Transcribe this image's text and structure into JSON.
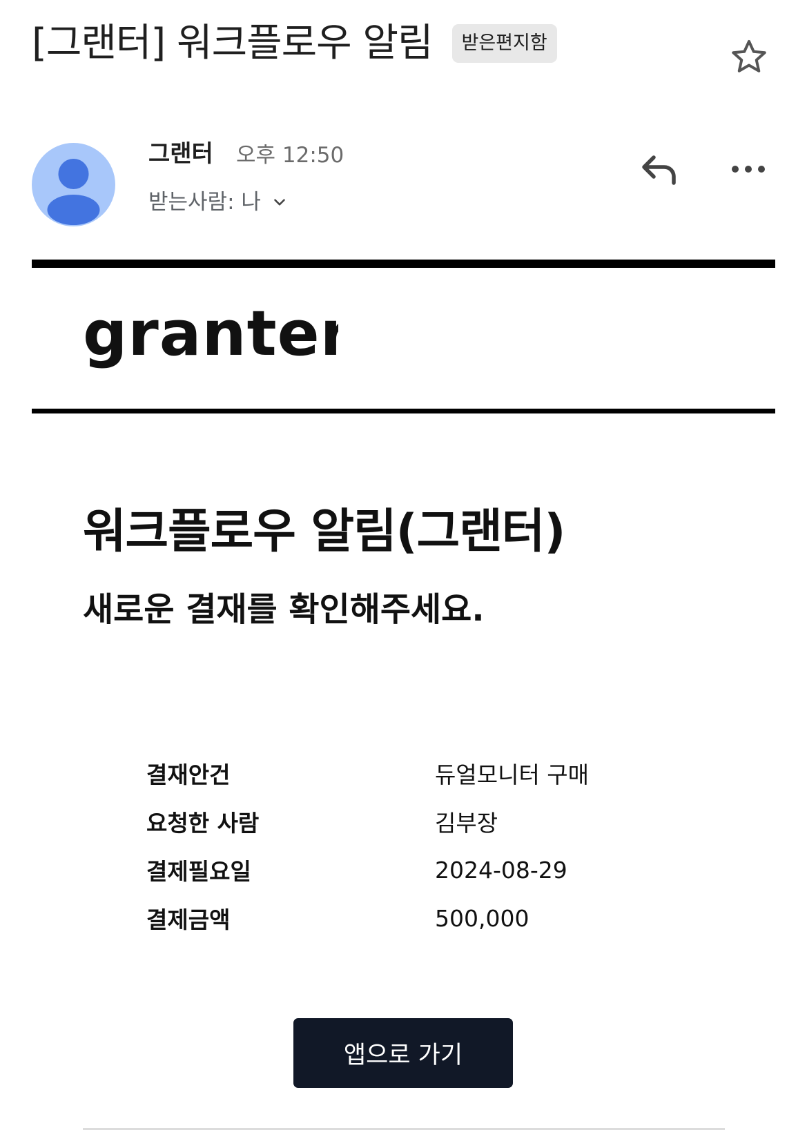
{
  "email": {
    "subject": "[그랜터] 워크플로우 알림",
    "label": "받은편지함",
    "sender": "그랜터",
    "time": "오후 12:50",
    "recipient": "받는사람: 나"
  },
  "icons": {
    "star": "star-outline-icon",
    "reply": "reply-icon",
    "more": "more-horizontal-icon",
    "avatar": "person-avatar-icon",
    "chevron": "chevron-down-icon"
  },
  "body": {
    "logo_text": "granter",
    "headline": "워크플로우 알림(그랜터)",
    "subheadline": "새로운 결재를 확인해주세요.",
    "details": [
      {
        "label": "결재안건",
        "value": "듀얼모니터 구매"
      },
      {
        "label": "요청한 사람",
        "value": "김부장"
      },
      {
        "label": "결제필요일",
        "value": "2024-08-29"
      },
      {
        "label": "결제금액",
        "value": "500,000"
      }
    ],
    "button_label": "앱으로 가기"
  },
  "colors": {
    "avatar_bg": "#a8c7fa",
    "avatar_fg": "#4374e0",
    "button_bg": "#111827",
    "chip_bg": "#e8e8e8"
  }
}
